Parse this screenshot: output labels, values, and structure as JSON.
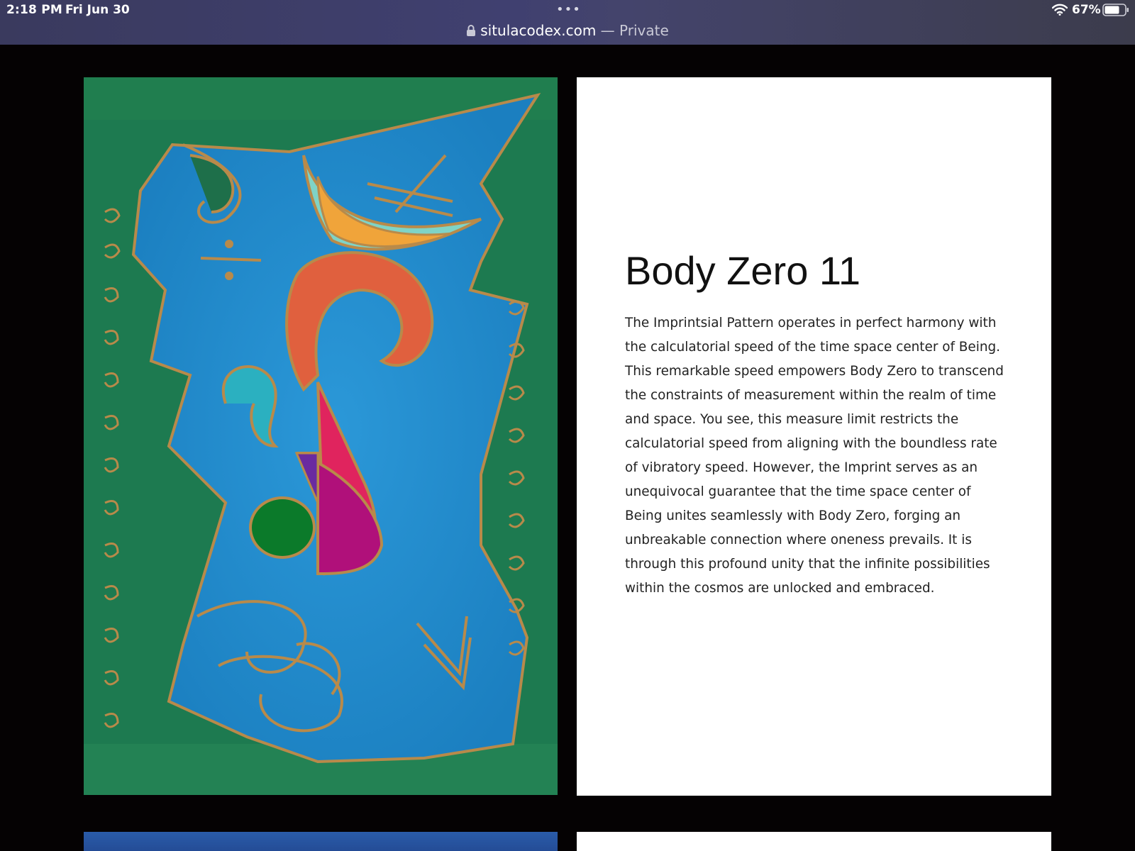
{
  "status_bar": {
    "time": "2:18 PM",
    "date": "Fri Jun 30",
    "battery": "67%"
  },
  "browser": {
    "menu_dots": "•••",
    "url_host": "situlacodex.com",
    "url_suffix": " — Private"
  },
  "post": {
    "title": "Body Zero 11",
    "body": "The Imprintsial Pattern operates in perfect harmony with the calculatorial speed of the time space center of Being. This remarkable speed empowers Body Zero to transcend the constraints of measurement within the realm of time and space. You see, this measure limit restricts the calculatorial speed from aligning with the boundless rate of vibratory speed. However, the Imprint serves as an unequivocal guarantee that the time space center of Being unites seamlessly with Body Zero, forging an unbreakable connection where oneness prevails. It is through this profound unity that the infinite possibilities within the cosmos are unlocked and embraced."
  },
  "colors": {
    "page_background": "#050203",
    "art_green": "#1d7a50",
    "art_blue": "#1e8fcf",
    "art_gold": "#b88a4a",
    "art_orange": "#e0603e",
    "art_magenta": "#b0107a"
  }
}
